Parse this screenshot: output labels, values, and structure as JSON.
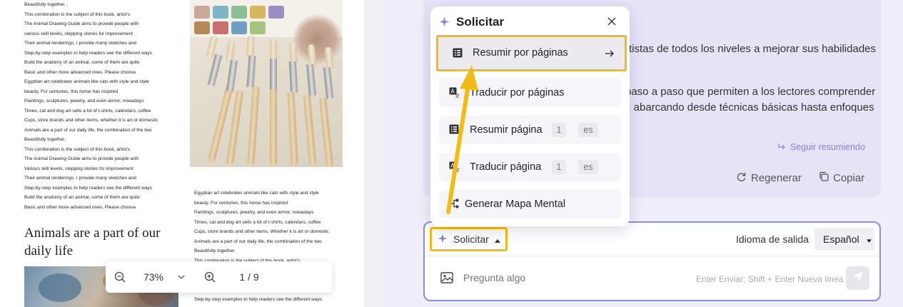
{
  "pdf": {
    "column_a": [
      "Beautifully together.  ,",
      "This combination is the subject of this book, artist's",
      "The Animal Drawing Guide aims to provide people with",
      "various skill levels, stepping stones for improvement",
      "Their animal renderings. I provide many sketches and",
      "Step-by-step examples to help readers see the different ways",
      "Build the anatomy of an animal, some of them are quite",
      "Basic and other more advanced ones. Please choose",
      "Egyptian art celebrates animals like cats with style and style",
      "beauty. For centuries, this horse has inspired",
      "Paintings, sculptures, jewelry, and even armor, nowadays",
      "Times, cat and dog art sells a lot of t-shirts, calendars, coffee",
      "Cups, store brands and other items, whether it is art or domestic",
      "Animals are a part of our daily life, the combination of the two",
      "Beautifully together.",
      "This combination is the subject of this book, artist's",
      "The Animal Drawing Guide aims to provide people with",
      "Various skill levels, stepping stones for improvement",
      "Their animal renderings. I provide many sketches and",
      "Step-by-step examples to help readers see the different ways",
      "Build the anatomy of an animal, some of them are quite",
      "Basic and other more advanced ones. Please choose"
    ],
    "heading": "Animals are a part of our daily life",
    "column_b": [
      "Egyptian art celebrates animals like cats with style and style",
      "beauty. For centuries, this horse has inspired",
      "Paintings, sculptures, jewelry, and even armor, nowadays",
      "Times, cat and dog art sells a lot of t-shirts, calendars, coffee",
      "Cups, store brands and other items. Whether it is art or domestic",
      "Animals are a part of our daily life, the combination of the two",
      "Beautifully together.",
      "This combination is the subject of this book, artist's",
      "o provide people with",
      "s for improvement",
      "many sketches and",
      "Step-by-step examples to help readers see the different ways"
    ]
  },
  "zoom": {
    "level": "73%",
    "page": "1 / 9"
  },
  "ai_panel": {
    "response_line_1": "rtistas de todos los niveles a mejorar sus habilidades",
    "response_line_2": "paso a paso que permiten a los lectores comprender",
    "response_line_3": "l, abarcando desde técnicas básicas hasta enfoques",
    "continue_label": "Seguir resumiendo",
    "regenerate_label": "Regenerar",
    "copy_label": "Copiar"
  },
  "menu": {
    "title": "Solicitar",
    "items": [
      {
        "label": "Resumir por páginas"
      },
      {
        "label": "Traducir por páginas"
      },
      {
        "label": "Resumir página",
        "page": "1",
        "lang": "es"
      },
      {
        "label": "Traducir página",
        "page": "1",
        "lang": "es"
      },
      {
        "label": "Generar Mapa Mental"
      }
    ]
  },
  "input": {
    "prompt_button": "Solicitar",
    "output_language_label": "Idioma de salida",
    "output_language": "Español",
    "placeholder": "Pregunta algo",
    "hint": "Enter Enviar; Shift + Enter Nueva línea"
  },
  "colors": {
    "accent": "#8b7ee0",
    "highlight": "#f2bc17",
    "panel_bg": "#efeefa"
  },
  "icons": [
    "sparkle-icon",
    "close-icon",
    "list-icon",
    "translate-icon",
    "mindmap-icon",
    "arrow-right-icon",
    "zoom-out-icon",
    "zoom-in-icon",
    "chevron-down-icon",
    "caret-up-icon",
    "caret-down-icon",
    "image-icon",
    "send-icon",
    "regenerate-icon",
    "copy-icon",
    "continue-icon"
  ]
}
